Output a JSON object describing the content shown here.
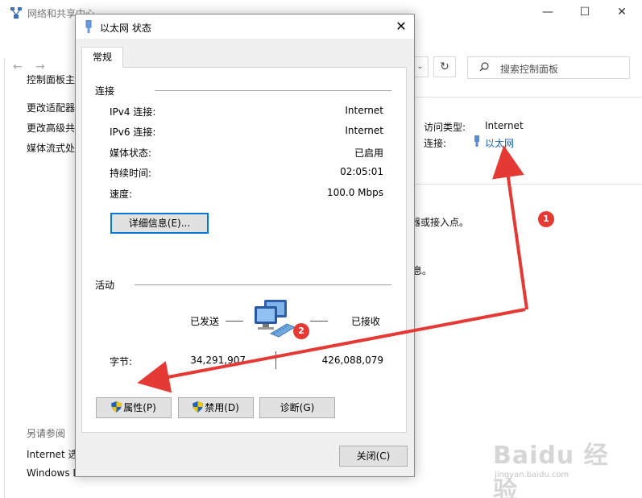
{
  "background_window": {
    "title": "网络和共享中心",
    "search_placeholder": "搜索控制面板",
    "sidebar": {
      "home": "控制面板主",
      "links": [
        "更改适配器",
        "更改高级共",
        "媒体流式处"
      ],
      "see_also_title": "另请参阅",
      "see_also_links": [
        "Internet 选",
        "Windows D"
      ]
    },
    "right_panel": {
      "access_type_label": "访问类型:",
      "access_type_value": "Internet",
      "connection_label": "连接:",
      "connection_value": "以太网",
      "fragment_1": "器或接入点。",
      "fragment_2": "息。"
    }
  },
  "dialog": {
    "title": "以太网 状态",
    "tab_general": "常规",
    "connection": {
      "group_title": "连接",
      "rows": [
        {
          "label": "IPv4 连接:",
          "value": "Internet"
        },
        {
          "label": "IPv6 连接:",
          "value": "Internet"
        },
        {
          "label": "媒体状态:",
          "value": "已启用"
        },
        {
          "label": "持续时间:",
          "value": "02:05:01"
        },
        {
          "label": "速度:",
          "value": "100.0 Mbps"
        }
      ],
      "details_button": "详细信息(E)..."
    },
    "activity": {
      "group_title": "活动",
      "sent_label": "已发送",
      "received_label": "已接收",
      "bytes_label": "字节:",
      "bytes_sent": "34,291,907",
      "bytes_received": "426,088,079"
    },
    "buttons": {
      "properties": "属性(P)",
      "disable": "禁用(D)",
      "diagnose": "诊断(G)",
      "close": "关闭(C)"
    }
  },
  "annotations": {
    "badge_1": "1",
    "badge_2": "2",
    "arrow_color": "#e53935"
  },
  "watermark": {
    "brand": "Baidu 经验",
    "url": "jingyan.baidu.com"
  }
}
